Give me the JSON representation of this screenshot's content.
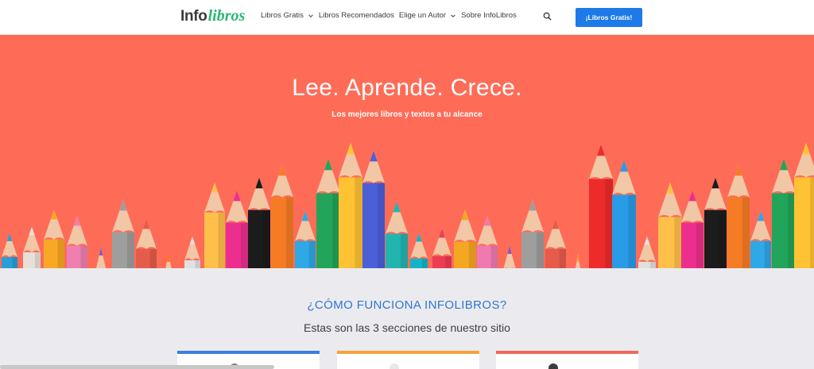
{
  "header": {
    "logo": {
      "part1": "Info",
      "part2": "libros"
    },
    "nav": [
      {
        "label": "Libros Gratis",
        "has_dropdown": true
      },
      {
        "label": "Libros Recomendados",
        "has_dropdown": false
      },
      {
        "label": "Elige un Autor",
        "has_dropdown": true
      },
      {
        "label": "Sobre InfoLibros",
        "has_dropdown": false
      }
    ],
    "search_icon": "search-icon",
    "cta_label": "¡Libros Gratis!"
  },
  "hero": {
    "title": "Lee. Aprende. Crece.",
    "subtitle": "Los mejores libros y textos a tu alcance"
  },
  "section": {
    "title": "¿CÓMO FUNCIONA INFOLIBROS?",
    "subtitle": "Estas son las 3 secciones de nuestro sitio"
  },
  "cards": [
    {
      "accent": "#3a7fe0"
    },
    {
      "accent": "#f5a43a"
    },
    {
      "accent": "#f0695b"
    }
  ],
  "colors": {
    "hero_bg": "#fe6c58",
    "brand_green": "#2bb673",
    "cta_blue": "#1d7ae8",
    "section_title": "#2e77d0"
  }
}
